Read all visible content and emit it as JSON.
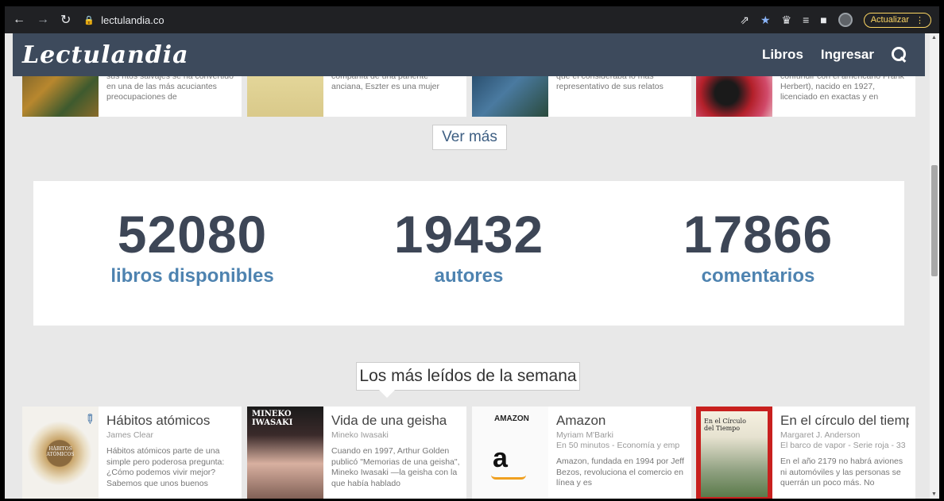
{
  "browser": {
    "url": "lectulandia.co",
    "update_label": "Actualizar"
  },
  "header": {
    "logo": "Lectulandia",
    "nav": [
      "Libros",
      "Ingresar"
    ]
  },
  "top_books": [
    {
      "desc": "sus ritos salvajes se ha convertido en una de las más acuciantes preocupaciones de"
    },
    {
      "desc": "compañía de una pariente anciana, Eszter es una mujer"
    },
    {
      "desc": "que el consideraba lo más representativo de sus relatos"
    },
    {
      "desc": "confundir con el americano Frank Herbert), nacido en 1927, licenciado en exactas y en"
    }
  ],
  "ver_mas": "Ver más",
  "stats": [
    {
      "value": "52080",
      "label": "libros disponibles"
    },
    {
      "value": "19432",
      "label": "autores"
    },
    {
      "value": "17866",
      "label": "comentarios"
    }
  ],
  "section_title": "Los más leídos de la semana",
  "books": [
    {
      "title": "Hábitos atómicos",
      "author": "James Clear",
      "series": "",
      "desc": "Hábitos atómicos parte de una simple pero poderosa pregunta: ¿Cómo podemos vivir mejor? Sabemos que unos buenos",
      "cover_text": "HÁBITOS ATÓMICOS"
    },
    {
      "title": "Vida de una geisha",
      "author": "Mineko Iwasaki",
      "series": "",
      "desc": "Cuando en 1997, Arthur Golden publicó \"Memorias de una geisha\", Mineko Iwasaki —la geisha con la que había hablado",
      "cover_text": "MINEKO IWASAKI"
    },
    {
      "title": "Amazon",
      "author": "Myriam M'Barki",
      "series": "En 50 minutos - Economía y emp",
      "desc": "Amazon, fundada en 1994 por Jeff Bezos, revoluciona el comercio en línea y es",
      "cover_text": "AMAZON"
    },
    {
      "title": "En el círculo del tiempo",
      "author": "Margaret J. Anderson",
      "series": "El barco de vapor - Serie roja - 33",
      "desc": "En el año 2179 no habrá aviones ni automóviles y las personas se querrán un poco más. No",
      "cover_text": "En el Círculo del Tiempo"
    }
  ]
}
